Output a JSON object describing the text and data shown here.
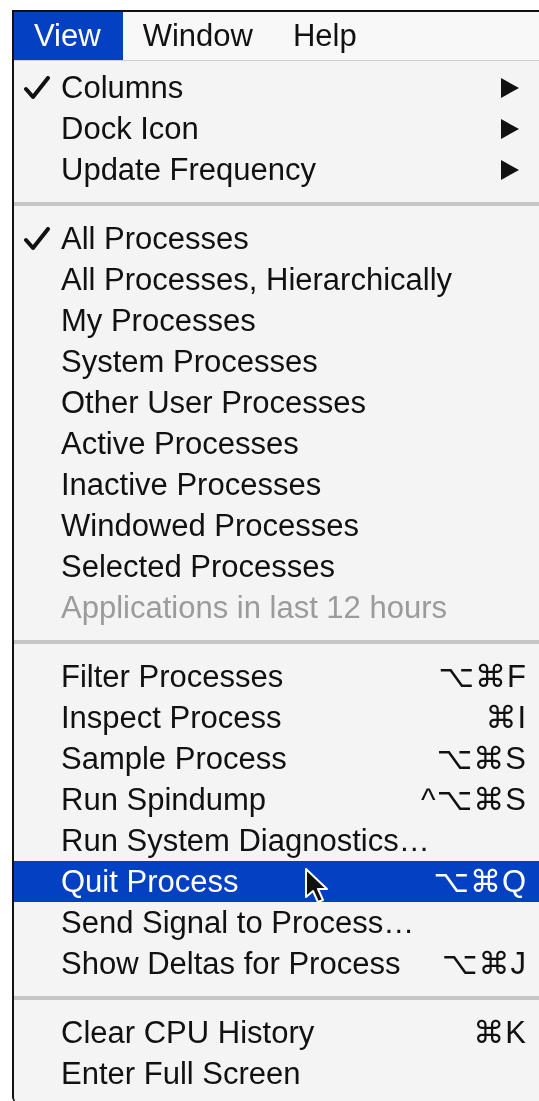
{
  "menu_bar": [
    {
      "label": "View",
      "selected": true
    },
    {
      "label": "Window",
      "selected": false
    },
    {
      "label": "Help",
      "selected": false
    }
  ],
  "menu": {
    "sections": [
      {
        "items": [
          {
            "label": "Columns",
            "checked": true,
            "submenu": true,
            "disabled": false,
            "selected": false
          },
          {
            "label": "Dock Icon",
            "checked": false,
            "submenu": true,
            "disabled": false,
            "selected": false
          },
          {
            "label": "Update Frequency",
            "checked": false,
            "submenu": true,
            "disabled": false,
            "selected": false
          }
        ]
      },
      {
        "items": [
          {
            "label": "All Processes",
            "checked": true,
            "submenu": false,
            "disabled": false,
            "selected": false
          },
          {
            "label": "All Processes, Hierarchically",
            "checked": false,
            "submenu": false,
            "disabled": false,
            "selected": false
          },
          {
            "label": "My Processes",
            "checked": false,
            "submenu": false,
            "disabled": false,
            "selected": false
          },
          {
            "label": "System Processes",
            "checked": false,
            "submenu": false,
            "disabled": false,
            "selected": false
          },
          {
            "label": "Other User Processes",
            "checked": false,
            "submenu": false,
            "disabled": false,
            "selected": false
          },
          {
            "label": "Active Processes",
            "checked": false,
            "submenu": false,
            "disabled": false,
            "selected": false
          },
          {
            "label": "Inactive Processes",
            "checked": false,
            "submenu": false,
            "disabled": false,
            "selected": false
          },
          {
            "label": "Windowed Processes",
            "checked": false,
            "submenu": false,
            "disabled": false,
            "selected": false
          },
          {
            "label": "Selected Processes",
            "checked": false,
            "submenu": false,
            "disabled": false,
            "selected": false
          },
          {
            "label": "Applications in last 12 hours",
            "checked": false,
            "submenu": false,
            "disabled": true,
            "selected": false
          }
        ]
      },
      {
        "items": [
          {
            "label": "Filter Processes",
            "shortcut": "⌥⌘F",
            "checked": false,
            "submenu": false,
            "disabled": false,
            "selected": false
          },
          {
            "label": "Inspect Process",
            "shortcut": "⌘I",
            "checked": false,
            "submenu": false,
            "disabled": false,
            "selected": false
          },
          {
            "label": "Sample Process",
            "shortcut": "⌥⌘S",
            "checked": false,
            "submenu": false,
            "disabled": false,
            "selected": false
          },
          {
            "label": "Run Spindump",
            "shortcut": "^⌥⌘S",
            "checked": false,
            "submenu": false,
            "disabled": false,
            "selected": false
          },
          {
            "label": "Run System Diagnostics…",
            "checked": false,
            "submenu": false,
            "disabled": false,
            "selected": false
          },
          {
            "label": "Quit Process",
            "shortcut": "⌥⌘Q",
            "checked": false,
            "submenu": false,
            "disabled": false,
            "selected": true
          },
          {
            "label": "Send Signal to Process…",
            "checked": false,
            "submenu": false,
            "disabled": false,
            "selected": false
          },
          {
            "label": "Show Deltas for Process",
            "shortcut": "⌥⌘J",
            "checked": false,
            "submenu": false,
            "disabled": false,
            "selected": false
          }
        ]
      },
      {
        "items": [
          {
            "label": "Clear CPU History",
            "shortcut": "⌘K",
            "checked": false,
            "submenu": false,
            "disabled": false,
            "selected": false
          },
          {
            "label": "Enter Full Screen",
            "checked": false,
            "submenu": false,
            "disabled": false,
            "selected": false
          }
        ]
      }
    ]
  }
}
